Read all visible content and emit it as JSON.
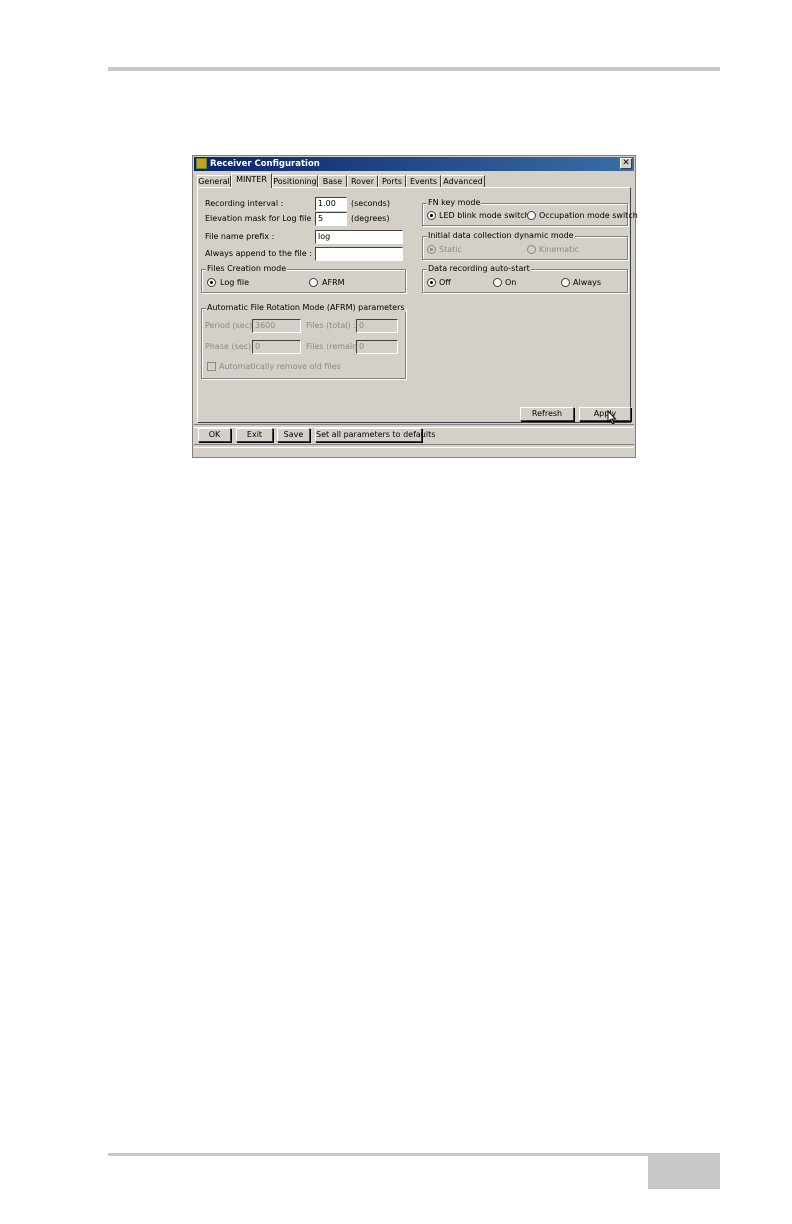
{
  "window": {
    "title": "Receiver Configuration",
    "close_glyph": "✕"
  },
  "tabs": [
    {
      "label": "General"
    },
    {
      "label": "MINTER"
    },
    {
      "label": "Positioning"
    },
    {
      "label": "Base"
    },
    {
      "label": "Rover"
    },
    {
      "label": "Ports"
    },
    {
      "label": "Events"
    },
    {
      "label": "Advanced"
    }
  ],
  "active_tab": "MINTER",
  "fields": {
    "recording_interval": {
      "label": "Recording interval :",
      "value": "1.00",
      "unit": "(seconds)"
    },
    "elevation_mask": {
      "label": "Elevation mask for Log file :",
      "value": "5",
      "unit": "(degrees)"
    },
    "file_name_prefix": {
      "label": "File name prefix :",
      "value": "log"
    },
    "always_append": {
      "label": "Always append to the file :",
      "value": ""
    }
  },
  "files_creation_mode": {
    "title": "Files Creation mode",
    "options": [
      "Log file",
      "AFRM"
    ],
    "selected": "Log file"
  },
  "afrm": {
    "title": "Automatic File Rotation Mode (AFRM) parameters",
    "period_label": "Period (sec) :",
    "period_value": "3600",
    "files_total_label": "Files (total) :",
    "files_total_value": "0",
    "phase_label": "Phase (sec) :",
    "phase_value": "0",
    "files_remain_label": "Files (remain) :",
    "files_remain_value": "0",
    "auto_remove_label": "Automatically remove old files"
  },
  "fn_key_mode": {
    "title": "FN key mode",
    "options": [
      "LED blink mode switch",
      "Occupation mode switch"
    ],
    "selected": "LED blink mode switch"
  },
  "initial_dynamic_mode": {
    "title": "Initial data collection dynamic mode",
    "options": [
      "Static",
      "Kinematic"
    ],
    "selected": "Static"
  },
  "auto_start": {
    "title": "Data recording auto-start",
    "options": [
      "Off",
      "On",
      "Always"
    ],
    "selected": "Off"
  },
  "buttons": {
    "refresh": "Refresh",
    "apply": "Apply",
    "ok": "OK",
    "exit": "Exit",
    "save": "Save",
    "defaults": "Set all parameters to defaults"
  },
  "colors": {
    "dialog_bg": "#d4d0c8",
    "titlebar_start": "#0a246a",
    "titlebar_end": "#3a6ea5",
    "page_rule": "#c8c8c8"
  }
}
